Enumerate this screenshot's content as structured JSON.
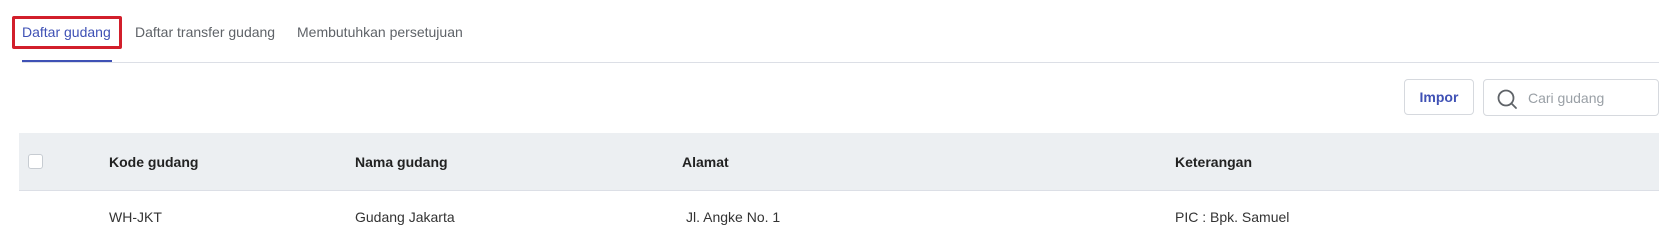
{
  "tabs": [
    {
      "label": "Daftar gudang",
      "active": true
    },
    {
      "label": "Daftar transfer gudang",
      "active": false
    },
    {
      "label": "Membutuhkan persetujuan",
      "active": false
    }
  ],
  "toolbar": {
    "import_label": "Impor",
    "search_placeholder": "Cari gudang",
    "search_value": ""
  },
  "table": {
    "columns": [
      "Kode gudang",
      "Nama gudang",
      "Alamat",
      "Keterangan"
    ],
    "rows": [
      {
        "code": "WH-JKT",
        "name": "Gudang Jakarta",
        "address": "Jl. Angke No. 1",
        "note": "PIC : Bpk. Samuel"
      }
    ]
  },
  "colors": {
    "accent": "#3f51b5",
    "link": "#3f6ad8",
    "focus_frame": "#d21f2b",
    "header_bg": "#eceff2"
  }
}
